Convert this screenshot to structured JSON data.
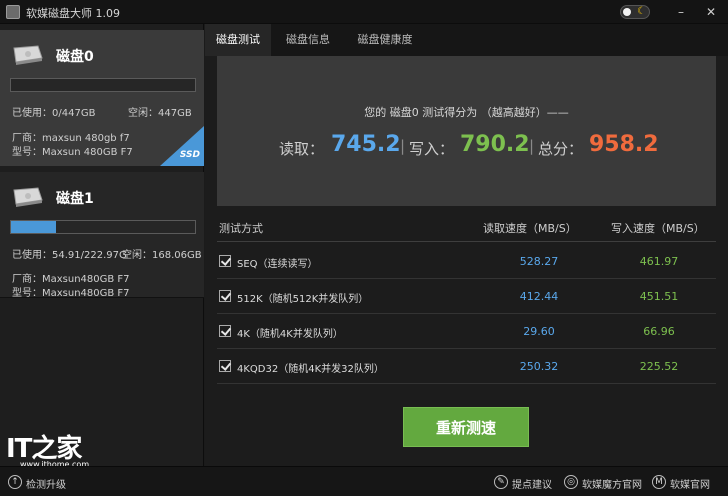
{
  "window": {
    "title": "软媒磁盘大师 1.09",
    "controls": {
      "minimize": "–",
      "close": "✕"
    }
  },
  "colors": {
    "read": "#5aa8ec",
    "write": "#7dc04f",
    "total": "#f06b3d",
    "accent": "#4a98d8",
    "button": "#63a93f"
  },
  "sidebar": {
    "disks": [
      {
        "name": "磁盘0",
        "used_label": "已使用：0/447GB",
        "free_label": "空闲：447GB",
        "usage_fraction": 0.0,
        "vendor_label": "厂商：maxsun  480gb f7",
        "model_label": "型号：Maxsun  480GB F7",
        "badge": "SSD"
      },
      {
        "name": "磁盘1",
        "used_label": "已使用：54.91/222.97G",
        "free_label": "空闲：168.06GB",
        "usage_fraction": 0.246,
        "vendor_label": "厂商：Maxsun480GB F7",
        "model_label": "型号：Maxsun480GB F7"
      }
    ]
  },
  "tabs": [
    {
      "label": "磁盘测试"
    },
    {
      "label": "磁盘信息"
    },
    {
      "label": "磁盘健康度"
    }
  ],
  "score": {
    "caption": "您的  磁盘0  测试得分为  （越高越好）——",
    "read_label": "读取：",
    "read_value": "745.2",
    "write_label": "写入：",
    "write_value": "790.2",
    "total_label": "总分：",
    "total_value": "958.2",
    "separator": "|"
  },
  "table": {
    "headers": {
      "method": "测试方式",
      "read": "读取速度（MB/S）",
      "write": "写入速度（MB/S）"
    },
    "rows": [
      {
        "label": "SEQ（连续读写）",
        "read": "528.27",
        "write": "461.97"
      },
      {
        "label": "512K（随机512K并发队列）",
        "read": "412.44",
        "write": "451.51"
      },
      {
        "label": "4K（随机4K并发队列）",
        "read": "29.60",
        "write": "66.96"
      },
      {
        "label": "4KQD32（随机4K并发32队列）",
        "read": "250.32",
        "write": "225.52"
      }
    ]
  },
  "retest_button": "重新测速",
  "statusbar": {
    "update": "检测升级",
    "suggest": "提点建议",
    "mofang": "软媒魔方官网",
    "official": "软媒官网"
  },
  "watermark": {
    "logo": "IT之家",
    "url": "www.ithome.com"
  }
}
